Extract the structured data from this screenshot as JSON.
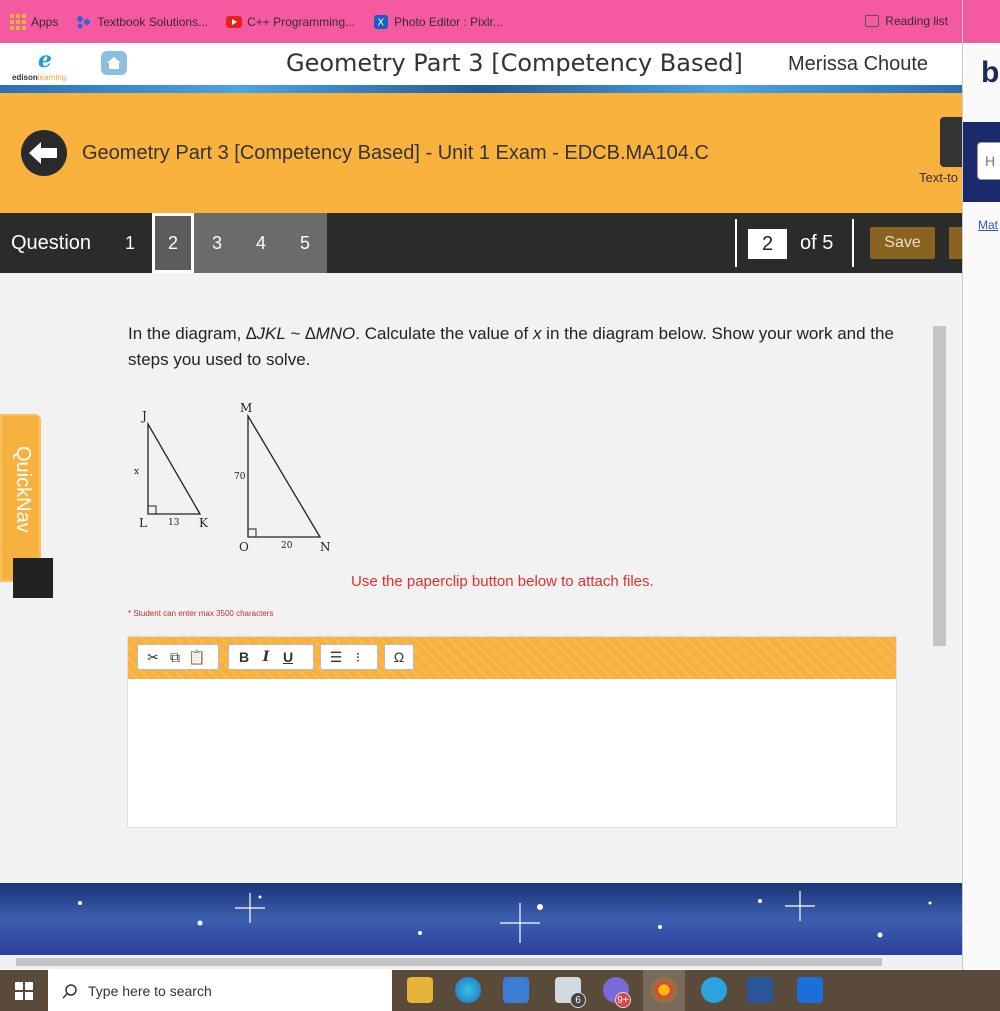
{
  "bookmarks": {
    "items": [
      {
        "label": "Apps",
        "icon": "apps-grid-icon"
      },
      {
        "label": "Textbook Solutions...",
        "icon": "textbook-icon"
      },
      {
        "label": "C++ Programming...",
        "icon": "youtube-icon"
      },
      {
        "label": "Photo Editor : Pixlr...",
        "icon": "pixlr-icon"
      }
    ],
    "reading_list": "Reading list"
  },
  "header": {
    "logo_text_1": "edison",
    "logo_text_2": "learning",
    "course_title": "Geometry Part 3 [Competency Based]",
    "user_name": "Merissa Choute"
  },
  "banner": {
    "exam_title": "Geometry Part 3 [Competency Based] - Unit 1 Exam - EDCB.MA104.C",
    "tts_label": "Text-to"
  },
  "question_nav": {
    "label": "Question",
    "numbers": [
      "1",
      "2",
      "3",
      "4",
      "5"
    ],
    "current": "2",
    "page_value": "2",
    "of_label": "of",
    "total": "5",
    "save_label": "Save"
  },
  "question": {
    "text_prefix": "In the diagram, ",
    "tri1": "∆JKL",
    "similar": " ~ ",
    "tri2": "∆MNO",
    "text_mid": ". Calculate the value of ",
    "var": "x",
    "text_suffix": " in the diagram below. Show your work and the steps you used to solve.",
    "diagram": {
      "J": "J",
      "L": "L",
      "K": "K",
      "x": "x",
      "side_lk": "13",
      "M": "M",
      "O": "O",
      "N": "N",
      "side_mo": "70",
      "side_on": "20"
    },
    "attach_note": "Use the paperclip button below to attach files.",
    "limit_note": "* Student can enter max 3500 characters"
  },
  "editor": {
    "bold": "B",
    "italic": "I",
    "underline": "U",
    "omega": "Ω"
  },
  "quicknav": {
    "label": "QuickNav"
  },
  "right_panel": {
    "big_letter": "b",
    "input_text": "H",
    "link_text": "Mat"
  },
  "taskbar": {
    "search_placeholder": "Type here to search",
    "mail_badge": "6",
    "discord_badge": "9+"
  },
  "colors": {
    "bookmark_bar": "#f55aa0",
    "banner": "#f9b23e",
    "nav_bg": "#2b2b2b",
    "save_button": "#8a6320",
    "attach_note": "#e03030"
  }
}
